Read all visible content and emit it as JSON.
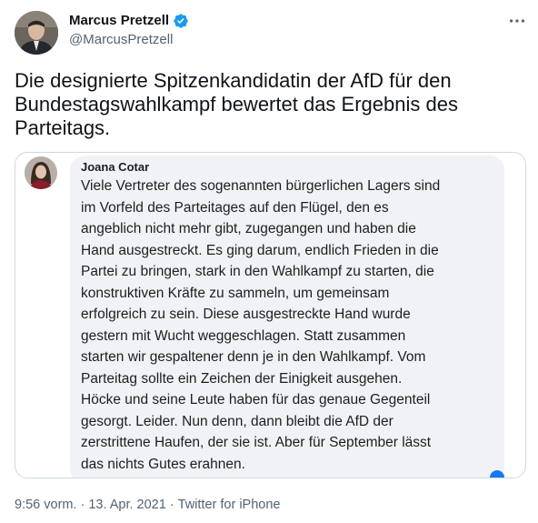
{
  "tweet": {
    "author": {
      "display_name": "Marcus Pretzell",
      "handle": "@MarcusPretzell",
      "verified": true,
      "avatar_icon": "profile-photo"
    },
    "text": "Die designierte Spitzenkandidatin der AfD für den\nBundestagswahlkampf bewertet das Ergebnis des\nParteitags.",
    "more_icon": "ellipsis-icon",
    "timestamp": "9:56 vorm.",
    "separator": "·",
    "date": "13. Apr. 2021",
    "source": "Twitter for iPhone"
  },
  "media": {
    "comment_author": "Joana Cotar",
    "comment_text": "Viele Vertreter des sogenannten bürgerlichen Lagers sind\nim Vorfeld des Parteitages auf den Flügel, den es\nangeblich nicht mehr gibt, zugegangen und haben die\nHand ausgestreckt. Es ging darum, endlich Frieden in die\nPartei zu bringen, stark in den Wahlkampf zu starten, die\nkonstruktiven Kräfte zu sammeln, um gemeinsam\nerfolgreich zu sein. Diese ausgestreckte Hand wurde\ngestern mit Wucht weggeschlagen. Statt zusammen\nstarten wir gespaltener denn je in den Wahlkampf. Vom\nParteitag sollte ein Zeichen der Einigkeit ausgehen.\nHöcke und seine Leute haben für das genaue Gegenteil\ngesorgt. Leider. Nun denn, dann bleibt die AfD der\nzerstrittene Haufen, der sie ist. Aber für September lässt\ndas nichts Gutes erahnen."
  },
  "colors": {
    "text_primary": "#0f1419",
    "text_secondary": "#536471",
    "verified_blue": "#1d9bf0",
    "border": "#cfd9de",
    "fb_bubble": "#f0f2f5",
    "fb_blue": "#1877f2"
  }
}
